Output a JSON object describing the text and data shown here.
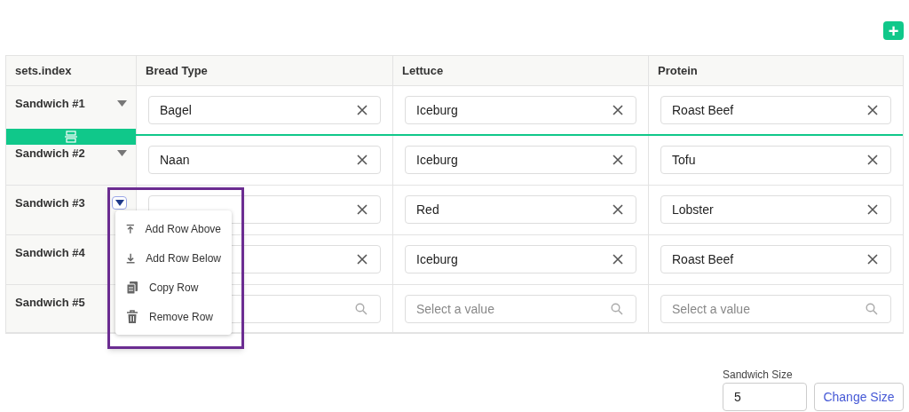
{
  "add_button": {
    "label": "+"
  },
  "table": {
    "columns": [
      "sets.index",
      "Bread Type",
      "Lettuce",
      "Protein"
    ],
    "rows": [
      {
        "menu_open": false,
        "drop_indicator": true,
        "cells": [
          {
            "kind": "index",
            "value": "Sandwich #1"
          },
          {
            "kind": "filled",
            "value": "Bagel"
          },
          {
            "kind": "filled",
            "value": "Iceburg"
          },
          {
            "kind": "filled",
            "value": "Roast Beef"
          }
        ]
      },
      {
        "menu_open": false,
        "drop_indicator": false,
        "cells": [
          {
            "kind": "index",
            "value": "Sandwich #2"
          },
          {
            "kind": "filled",
            "value": "Naan"
          },
          {
            "kind": "filled",
            "value": "Iceburg"
          },
          {
            "kind": "filled",
            "value": "Tofu"
          }
        ]
      },
      {
        "menu_open": true,
        "drop_indicator": false,
        "cells": [
          {
            "kind": "index",
            "value": "Sandwich #3"
          },
          {
            "kind": "filled"
          },
          {
            "kind": "filled",
            "value": "Red"
          },
          {
            "kind": "filled",
            "value": "Lobster"
          }
        ]
      },
      {
        "menu_open": false,
        "drop_indicator": false,
        "cells": [
          {
            "kind": "index",
            "value": "Sandwich #4"
          },
          {
            "kind": "filled"
          },
          {
            "kind": "filled",
            "value": "Iceburg"
          },
          {
            "kind": "filled",
            "value": "Roast Beef"
          }
        ]
      },
      {
        "menu_open": false,
        "drop_indicator": false,
        "cells": [
          {
            "kind": "index",
            "value": "Sandwich #5"
          },
          {
            "kind": "empty"
          },
          {
            "kind": "empty",
            "placeholder": "Select a value"
          },
          {
            "kind": "empty",
            "placeholder": "Select a value"
          }
        ]
      }
    ]
  },
  "row_menu": {
    "items": [
      {
        "kind": "above",
        "label": "Add Row Above"
      },
      {
        "kind": "below",
        "label": "Add Row Below"
      },
      {
        "kind": "copy",
        "label": "Copy Row"
      },
      {
        "kind": "remove",
        "label": "Remove Row"
      }
    ]
  },
  "size_form": {
    "label": "Sandwich Size",
    "value": "5",
    "button": "Change Size"
  }
}
